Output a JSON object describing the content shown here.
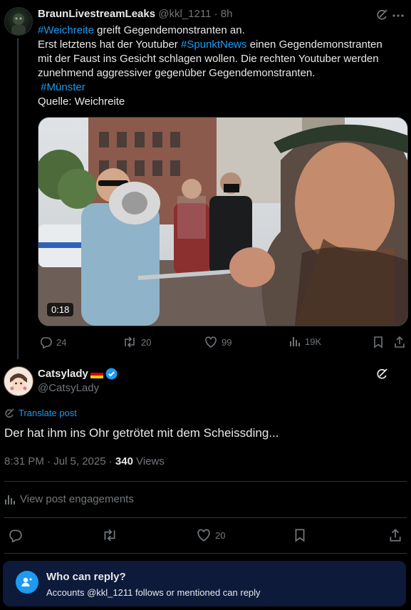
{
  "parent_tweet": {
    "display_name": "BraunLivestreamLeaks",
    "handle": "@kkl_1211",
    "separator": "·",
    "age": "8h",
    "text": {
      "hashtag_1": "#Weichreite",
      "line1_rest": " greift Gegendemonstranten an.",
      "line2_a": "Erst letztens hat der Youtuber ",
      "hashtag_2": "#SpunktNews",
      "line2_b": " einen Gegendemonstranten",
      "line3": "mit der Faust ins Gesicht schlagen wollen. Die rechten Youtuber werden",
      "line4": "zunehmend aggressiver gegenüber Gegendemonstranten.",
      "hashtag_3": " #Münster",
      "line6": "Quelle: Weichreite"
    },
    "video_duration": "0:18",
    "stats": {
      "replies": "24",
      "reposts": "20",
      "likes": "99",
      "views": "19K"
    }
  },
  "main_tweet": {
    "display_name": "Catsylady",
    "handle": "@CatsyLady",
    "translate_label": "Translate post",
    "text": "Der hat ihm ins Ohr getrötet mit dem Scheissding...",
    "time_date": "8:31 PM · Jul 5, 2025 · ",
    "views_count": "340",
    "views_label": " Views",
    "engagements_label": "View post engagements",
    "likes": "20"
  },
  "reply_restriction": {
    "title": "Who can reply?",
    "subtitle": "Accounts @kkl_1211 follows or mentioned can reply"
  },
  "colors": {
    "accent": "#1d9bf0",
    "muted": "#71767b",
    "background": "#000000",
    "reply_box": "#0d1a3a"
  },
  "icons": [
    "grok-icon",
    "more-icon",
    "reply-icon",
    "repost-icon",
    "like-icon",
    "views-icon",
    "bookmark-icon",
    "share-icon",
    "verified-badge-icon",
    "germany-flag-icon",
    "translate-icon",
    "engagements-icon",
    "mention-icon"
  ]
}
